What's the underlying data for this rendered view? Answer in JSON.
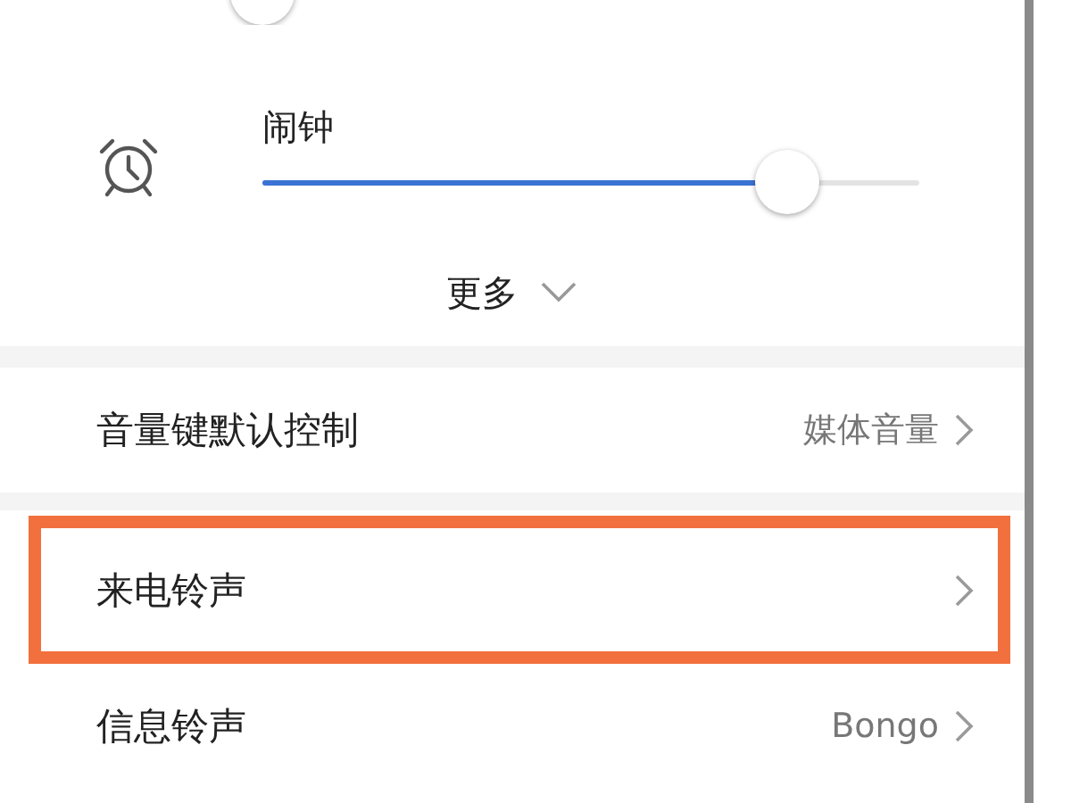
{
  "alarm": {
    "label": "闹钟",
    "level": 0.8
  },
  "more": {
    "label": "更多"
  },
  "rows": [
    {
      "label": "音量键默认控制",
      "value": "媒体音量",
      "highlighted": false
    },
    {
      "label": "来电铃声",
      "highlighted": true
    },
    {
      "label": "信息铃声",
      "value": "Bongo",
      "highlighted": false
    }
  ]
}
